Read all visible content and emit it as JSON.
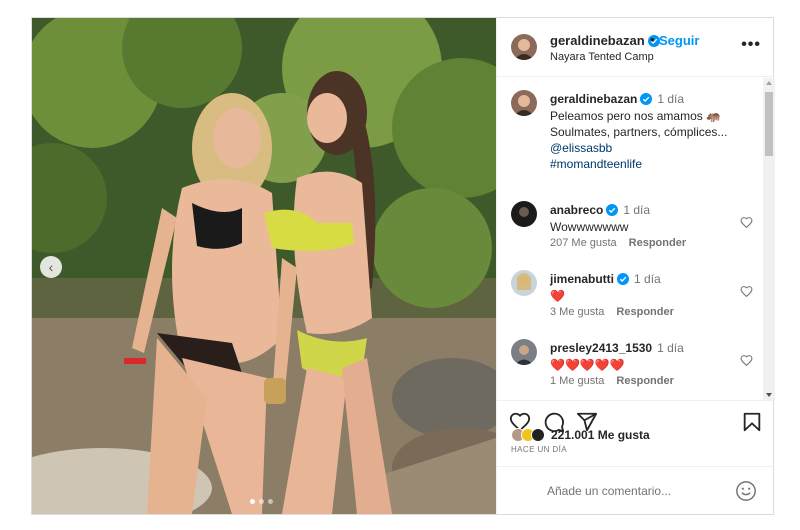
{
  "header": {
    "username": "geraldinebazan",
    "separator": "•",
    "follow_label": "Seguir",
    "location": "Nayara Tented Camp",
    "more_label": "•••"
  },
  "caption": {
    "username": "geraldinebazan",
    "time": "1 día",
    "lines": [
      "Peleamos pero nos amamos 🦛",
      "Soulmates, partners, cómplices..."
    ],
    "mention": "@elissasbb",
    "hashtag": "#momandteenlife"
  },
  "comments": [
    {
      "username": "anabreco",
      "verified": true,
      "time": "1 día",
      "text": "Wowwwwwww",
      "likes": "207 Me gusta",
      "reply": "Responder"
    },
    {
      "username": "jimenabutti",
      "verified": true,
      "time": "1 día",
      "text": "❤️",
      "likes": "3 Me gusta",
      "reply": "Responder"
    },
    {
      "username": "presley2413_1530",
      "verified": false,
      "time": "1 día",
      "text": "❤️❤️❤️❤️❤️",
      "likes": "1 Me gusta",
      "reply": "Responder"
    }
  ],
  "likes": {
    "count": "221.001 Me gusta"
  },
  "timestamp": "HACE UN DÍA",
  "add_comment": {
    "placeholder": "Añade un comentario..."
  },
  "carousel": {
    "current": 1,
    "total": 3
  },
  "colors": {
    "link": "#0095f6",
    "muted": "#737373",
    "text": "#262626",
    "border": "#dbdbdb",
    "verified": "#0095f6",
    "heart": "#ed1c24"
  },
  "icons": [
    "more-icon",
    "verified-icon",
    "heart-icon",
    "comment-icon",
    "share-icon",
    "bookmark-icon",
    "emoji-icon",
    "chevron-left-icon"
  ]
}
